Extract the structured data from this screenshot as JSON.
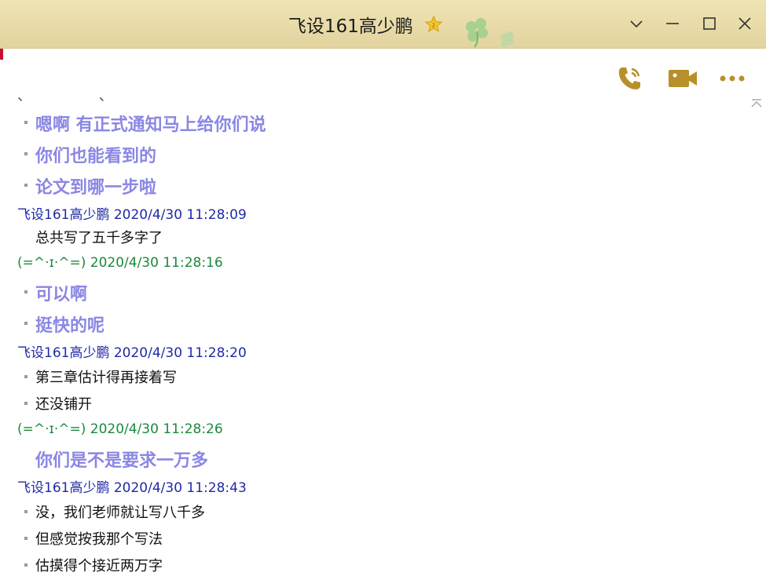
{
  "window": {
    "title": "飞设161高少鹏",
    "accent": "#b8860b",
    "titlebar_color": "#e8dba8"
  },
  "titlebar_icons": {
    "vip": "vip-star-icon",
    "decoration": "clover-icon",
    "dropdown": "chevron-down-icon",
    "minimize": "minimize-icon",
    "maximize": "maximize-icon",
    "close": "close-icon"
  },
  "toolbar": {
    "voice_call": "phone-icon",
    "video_call": "video-camera-icon",
    "more": "more-icon"
  },
  "colors": {
    "friend_header": "#1f2aa6",
    "my_header": "#1a8a3a",
    "big_text": "#8a87e4",
    "small_text": "#111111"
  },
  "chat": {
    "top_clipped": "、 、 、",
    "messages": [
      {
        "text": "嗯啊 有正式通知马上给你们说",
        "style": "big",
        "bullet": true
      },
      {
        "text": "你们也能看到的",
        "style": "big",
        "bullet": true
      },
      {
        "text": "论文到哪一步啦",
        "style": "big",
        "bullet": true
      },
      {
        "header": "飞设161高少鹏 2020/4/30 11:28:09",
        "side": "friend"
      },
      {
        "text": "总共写了五千多字了",
        "style": "small",
        "bullet": false
      },
      {
        "header": "(=^·ɪ·^=) 2020/4/30 11:28:16",
        "side": "me"
      },
      {
        "text": "可以啊",
        "style": "big",
        "bullet": true
      },
      {
        "text": "挺快的呢",
        "style": "big",
        "bullet": true
      },
      {
        "header": "飞设161高少鹏 2020/4/30 11:28:20",
        "side": "friend"
      },
      {
        "text": "第三章估计得再接着写",
        "style": "small",
        "bullet": true
      },
      {
        "text": "还没铺开",
        "style": "small",
        "bullet": true
      },
      {
        "header": "(=^·ɪ·^=) 2020/4/30 11:28:26",
        "side": "me"
      },
      {
        "text": "你们是不是要求一万多",
        "style": "big",
        "bullet": false
      },
      {
        "header": "飞设161高少鹏 2020/4/30 11:28:43",
        "side": "friend"
      },
      {
        "text": "没，我们老师就让写八千多",
        "style": "small",
        "bullet": true
      },
      {
        "text": "但感觉按我那个写法",
        "style": "small",
        "bullet": true
      },
      {
        "text": "估摸得个接近两万字",
        "style": "small",
        "bullet": true
      }
    ]
  }
}
